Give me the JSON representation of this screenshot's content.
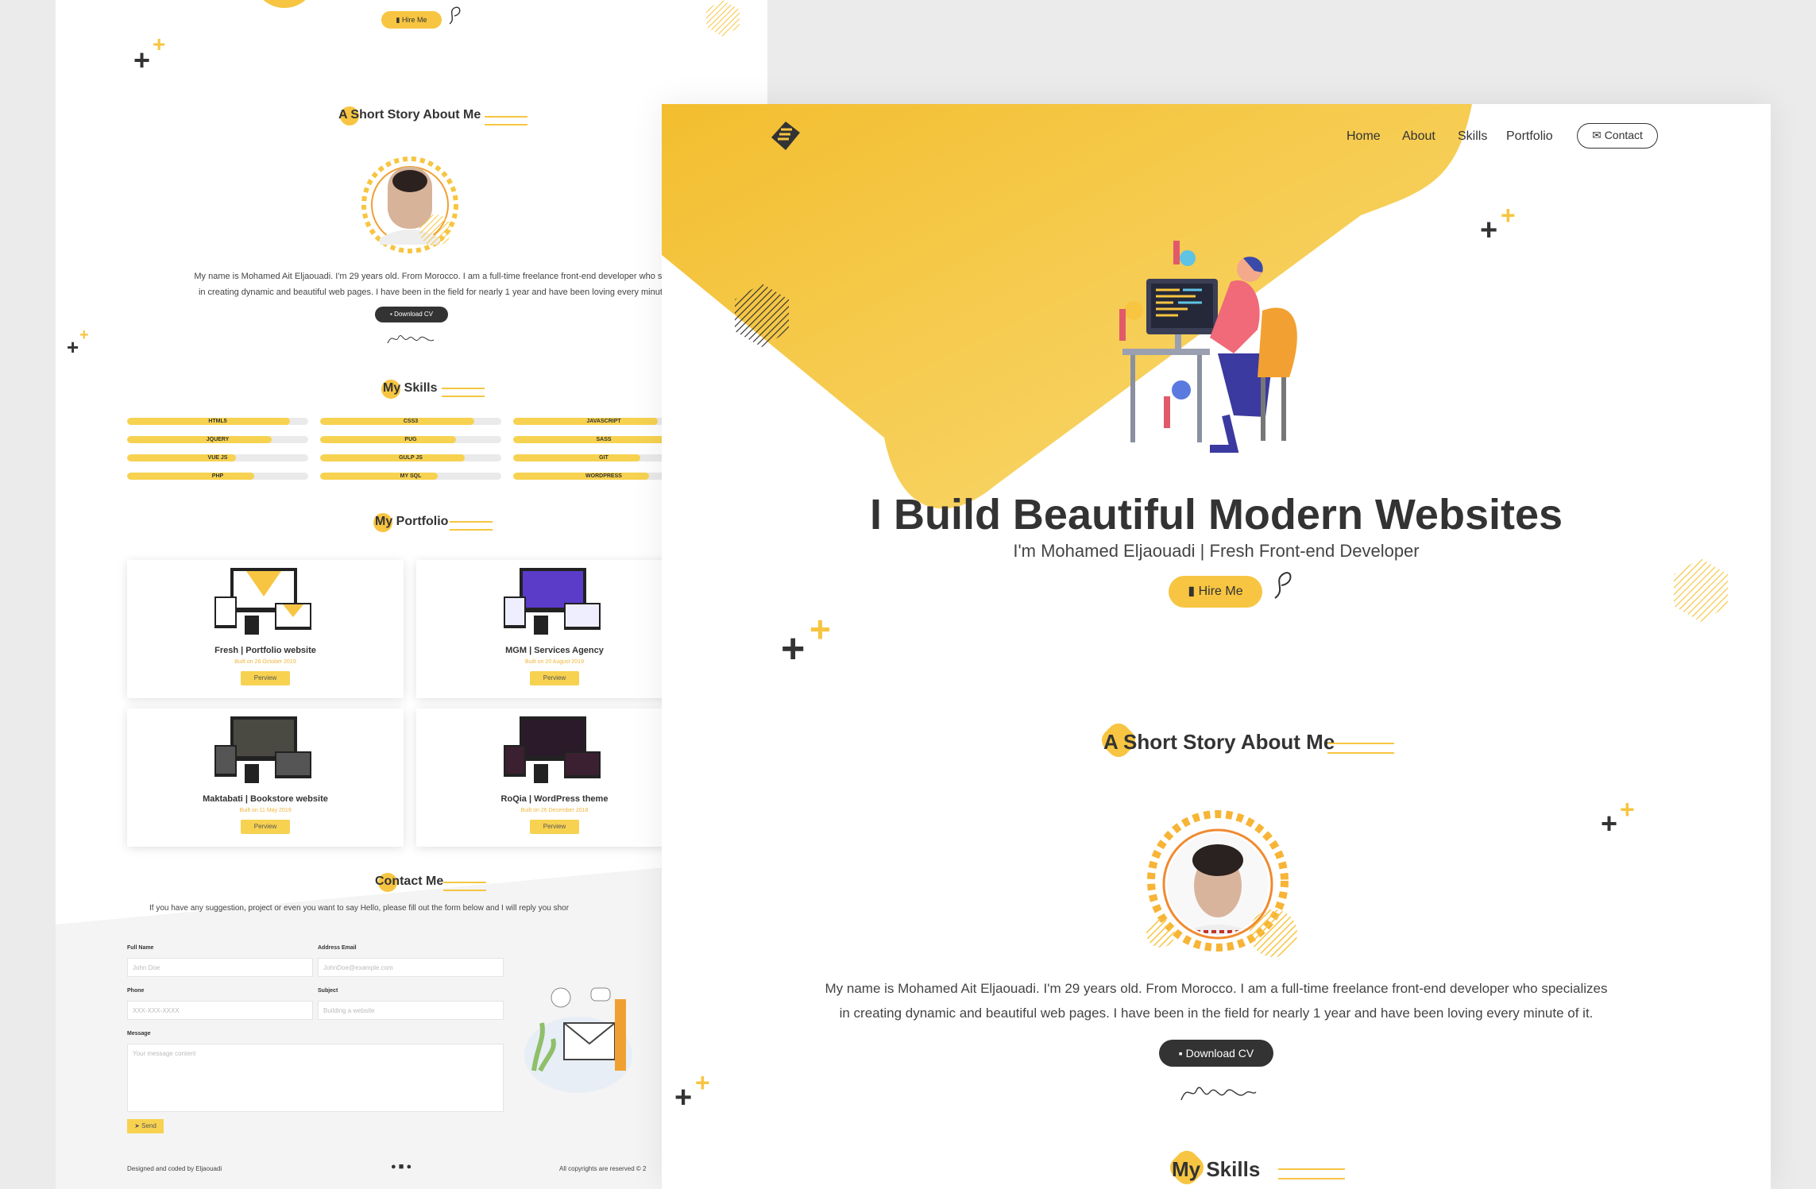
{
  "bg": {
    "hire_label": "Hire Me",
    "about_title": "A Short Story About Me",
    "about_text_1": "My name is Mohamed Ait Eljaouadi. I'm 29 years old. From Morocco. I am a full-time freelance front-end developer who spe",
    "about_text_2": "in creating dynamic and beautiful web pages. I have been in the field for nearly 1 year and have been loving every minute",
    "download_label": "Download CV",
    "skills_title": "My Skills",
    "skills": [
      {
        "name": "HTML5",
        "level": 0.9
      },
      {
        "name": "CSS3",
        "level": 0.85
      },
      {
        "name": "JAVASCRIPT",
        "level": 0.8
      },
      {
        "name": "JQUERY",
        "level": 0.8
      },
      {
        "name": "PUG",
        "level": 0.75
      },
      {
        "name": "SASS",
        "level": 0.85
      },
      {
        "name": "VUE JS",
        "level": 0.6
      },
      {
        "name": "GULP JS",
        "level": 0.8
      },
      {
        "name": "GIT",
        "level": 0.7
      },
      {
        "name": "PHP",
        "level": 0.7
      },
      {
        "name": "MY SQL",
        "level": 0.65
      },
      {
        "name": "WORDPRESS",
        "level": 0.75
      }
    ],
    "portfolio_title": "My Portfolio",
    "projects": [
      {
        "title": "Fresh | Portfolio website",
        "date": "Built on 26 October 2019",
        "button": "Perview"
      },
      {
        "title": "MGM | Services Agency",
        "date": "Built on 20 August 2019",
        "button": "Perview"
      },
      {
        "title": "Maktabati | Bookstore website",
        "date": "Built on 11 May 2019",
        "button": "Perview"
      },
      {
        "title": "RoQia | WordPress theme",
        "date": "Built on 26 December 2018",
        "button": "Perview"
      }
    ],
    "contact_title": "Contact Me",
    "contact_text": "If you have any suggestion, project or even you want to say Hello, please fill out the form below and I will reply you shor",
    "form": {
      "name_label": "Full Name",
      "name_placeholder": "John Doe",
      "email_label": "Address Email",
      "email_placeholder": "JohnDoe@example.com",
      "phone_label": "Phone",
      "phone_placeholder": "XXX-XXX-XXXX",
      "subject_label": "Subject",
      "subject_placeholder": "Building a website",
      "message_label": "Message",
      "message_placeholder": "Your message content",
      "send_label": "Send"
    },
    "footer_left": "Designed and coded by Eljaouadi",
    "footer_right": "All copyrights are reserved © 2"
  },
  "fg": {
    "nav": [
      "Home",
      "About",
      "Skills",
      "Portfolio"
    ],
    "contact_label": "Contact",
    "hero_title": "I Build Beautiful Modern Websites",
    "hero_subtitle": "I'm Mohamed Eljaouadi | Fresh Front-end Developer",
    "hire_label": "Hire Me",
    "about_title": "A Short Story About Me",
    "about_text_1": "My name is Mohamed Ait Eljaouadi. I'm 29 years old. From Morocco. I am a full-time freelance front-end developer who specializes",
    "about_text_2": "in creating dynamic and beautiful web pages. I have been in the field for nearly 1 year and have been loving every minute of it.",
    "download_label": "Download CV",
    "signature": "Mohamed Eljaouadi",
    "skills_title": "My Skills"
  },
  "colors": {
    "accent": "#f7c541",
    "dark": "#333333"
  }
}
